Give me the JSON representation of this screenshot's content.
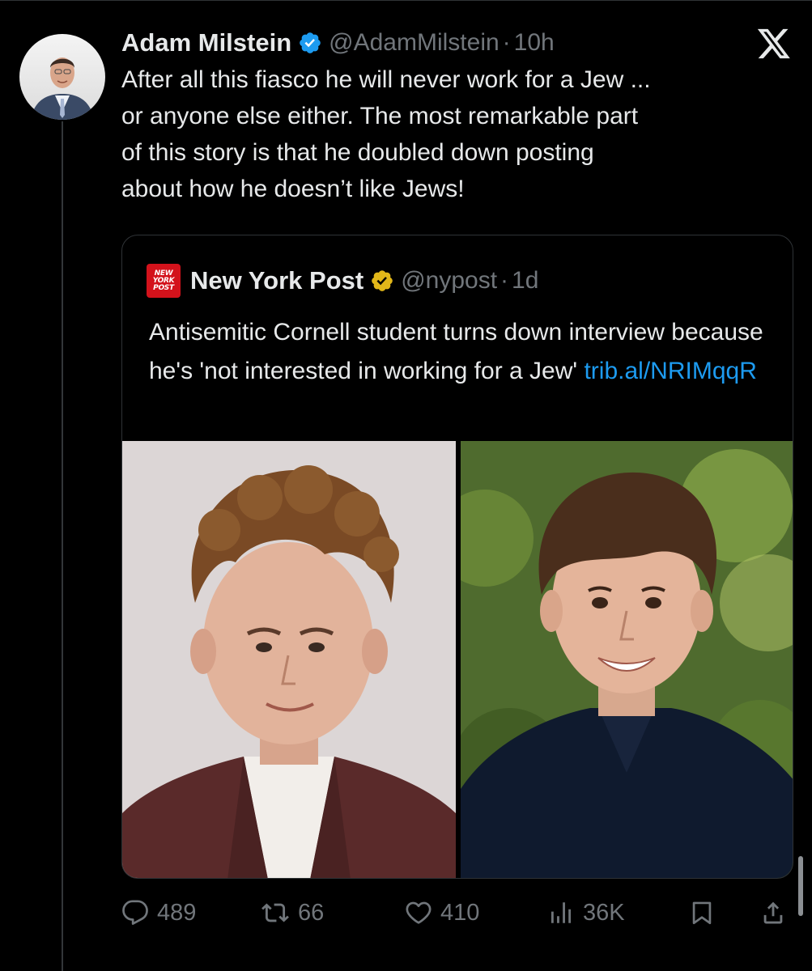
{
  "tweet": {
    "author": {
      "display_name": "Adam Milstein",
      "handle": "@AdamMilstein",
      "time": "10h",
      "verified": true
    },
    "text": "After all this fiasco he will never work for a Jew ...\nor anyone else either. The most remarkable part\nof this story is that he doubled down posting\nabout how he doesn’t like Jews!",
    "stats": {
      "replies": "489",
      "reposts": "66",
      "likes": "410",
      "views": "36K"
    }
  },
  "quoted_tweet": {
    "logo_text": [
      "NEW",
      "YORK",
      "POST"
    ],
    "display_name": "New York Post",
    "handle": "@nypost",
    "time": "1d",
    "text": "Antisemitic Cornell student turns down interview because he's 'not interested in working for a Jew'",
    "link": "trib.al/NRIMqqR"
  },
  "colors": {
    "background": "#000000",
    "text": "#e7e9ea",
    "secondary": "#71767b",
    "link": "#1d9bf0",
    "verified_blue": "#1d9bf0",
    "verified_gold": "#e2b719",
    "nypost_red": "#d3121b"
  },
  "icons": {
    "platform": "x-logo-icon",
    "reply": "speech-bubble-icon",
    "repost": "repost-arrows-icon",
    "like": "heart-icon",
    "views": "bar-chart-icon",
    "bookmark": "bookmark-icon",
    "share": "share-upload-icon"
  }
}
